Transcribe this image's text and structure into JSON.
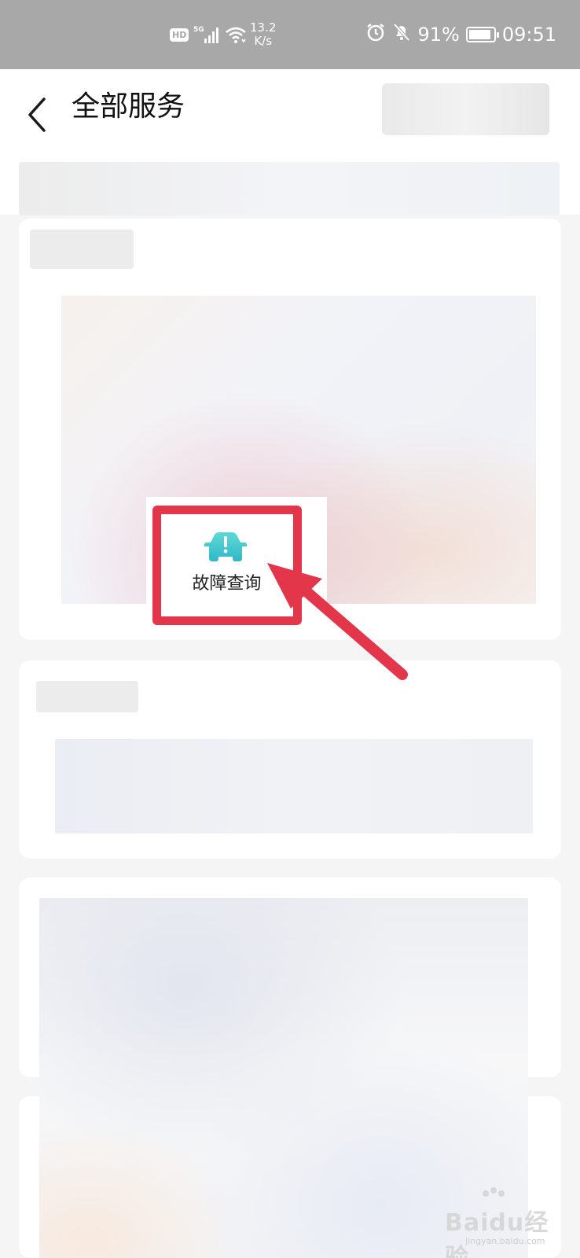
{
  "status_bar": {
    "network_badge": "HD",
    "signal_label": "5G",
    "speed_value": "13.2",
    "speed_unit": "K/s",
    "battery": "91%",
    "time": "09:51"
  },
  "header": {
    "title": "全部服务"
  },
  "service": {
    "label": "故障查询",
    "icon": "car-warning-icon",
    "icon_color": "#3ec5c8"
  },
  "annotation": {
    "color": "#e3364a"
  },
  "watermark": {
    "brand": "Baidu经验",
    "url": "jingyan.baidu.com"
  }
}
